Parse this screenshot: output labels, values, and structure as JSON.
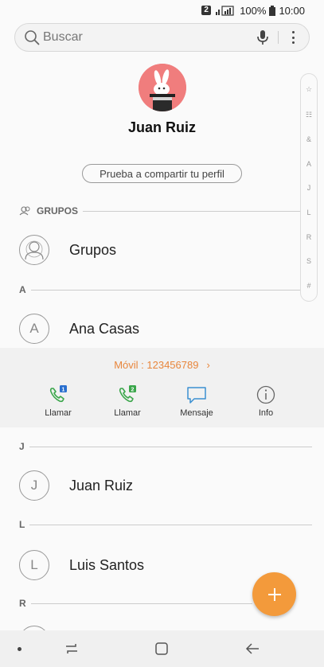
{
  "status_bar": {
    "sim_slot": "2",
    "battery": "100%",
    "time": "10:00"
  },
  "search": {
    "placeholder": "Buscar",
    "icons": [
      "search-icon",
      "microphone-icon",
      "more-options-icon"
    ]
  },
  "profile": {
    "name": "Juan Ruiz",
    "share_label": "Prueba a compartir tu perfil"
  },
  "index_bar": [
    "☆",
    "☷",
    "&",
    "A",
    "J",
    "L",
    "R",
    "S",
    "#"
  ],
  "sections": {
    "groups_header": "GRUPOS",
    "groups_item": "Grupos",
    "a_header": "A",
    "j_header": "J",
    "l_header": "L",
    "r_header": "R"
  },
  "contacts": {
    "ana": {
      "initial": "A",
      "name": "Ana Casas"
    },
    "juan": {
      "initial": "J",
      "name": "Juan Ruiz"
    },
    "luis": {
      "initial": "L",
      "name": "Luis Santos"
    }
  },
  "quick_actions": {
    "mobile_label": "Móvil : 123456789",
    "call1_label": "Llamar",
    "call1_sim": "1",
    "call2_label": "Llamar",
    "call2_sim": "2",
    "message_label": "Mensaje",
    "info_label": "Info"
  },
  "colors": {
    "accent_orange": "#f39a3b",
    "link_orange": "#e8863c",
    "call_green": "#3aa64a",
    "sim1_blue": "#2a6fcf",
    "message_blue": "#3a8fd1"
  }
}
